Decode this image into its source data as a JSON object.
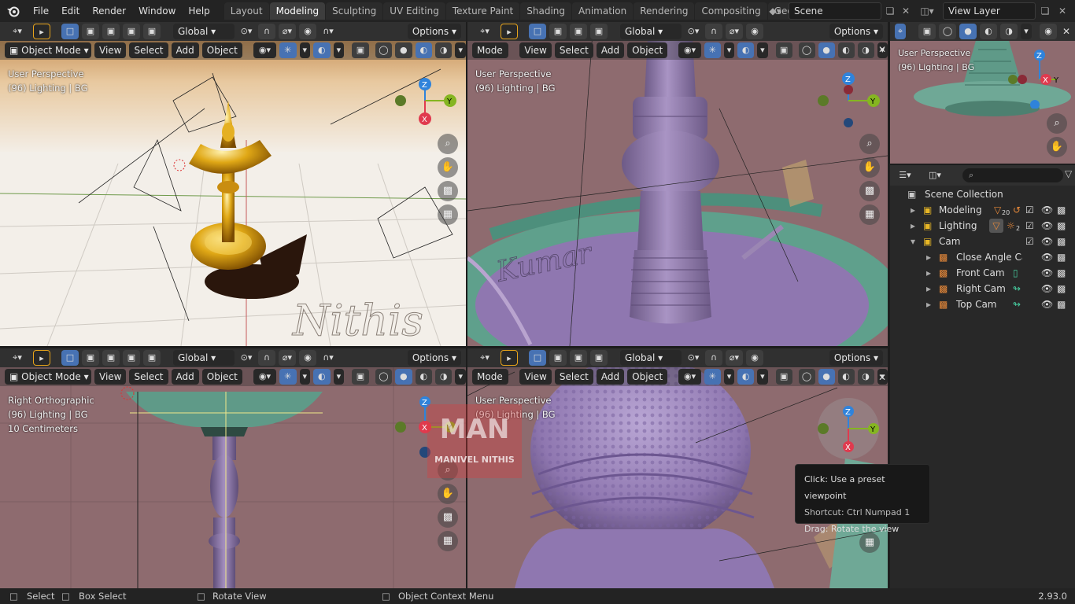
{
  "menus": [
    "File",
    "Edit",
    "Render",
    "Window",
    "Help"
  ],
  "workspace_tabs": [
    "Layout",
    "Modeling",
    "Sculpting",
    "UV Editing",
    "Texture Paint",
    "Shading",
    "Animation",
    "Rendering",
    "Compositing",
    "Geometry Nod"
  ],
  "active_tab": 1,
  "scene_name": "Scene",
  "view_layer_name": "View Layer",
  "viewport_header": {
    "transform": "Global",
    "options": "Options",
    "mode": "Object Mode",
    "mode_short": "Mode",
    "view": "View",
    "select": "Select",
    "add": "Add",
    "object": "Object"
  },
  "viewports": {
    "tl": {
      "line1": "User Perspective",
      "line2": "(96) Lighting | BG",
      "line3": ""
    },
    "tr": {
      "line1": "User Perspective",
      "line2": "(96) Lighting | BG",
      "line3": ""
    },
    "bl": {
      "line1": "Right Orthographic",
      "line2": "(96) Lighting | BG",
      "line3": "10 Centimeters"
    },
    "br": {
      "line1": "User Perspective",
      "line2": "(96) Lighting | BG",
      "line3": ""
    },
    "cam": {
      "line1": "User Perspective",
      "line2": "(96) Lighting | BG",
      "line3": ""
    }
  },
  "gizmo_axes": {
    "x": "X",
    "y": "Y",
    "z": "Z"
  },
  "outliner": {
    "root": "Scene Collection",
    "items": [
      {
        "label": "Modeling",
        "badge": "20",
        "level": 1
      },
      {
        "label": "Lighting",
        "badge": "2",
        "level": 1
      },
      {
        "label": "Cam",
        "badge": "",
        "level": 1
      },
      {
        "label": "Close Angle Cam",
        "badge": "",
        "level": 2
      },
      {
        "label": "Front Cam",
        "badge": "",
        "level": 2
      },
      {
        "label": "Right Cam",
        "badge": "",
        "level": 2
      },
      {
        "label": "Top Cam",
        "badge": "",
        "level": 2
      }
    ]
  },
  "tooltip": {
    "line1": "Click: Use a preset viewpoint",
    "line2": "Shortcut: Ctrl Numpad 1",
    "line3": "Drag: Rotate the view"
  },
  "watermarks": {
    "signature": "Nithis",
    "signature2": "Kumar",
    "badge": "MANIVEL NITHIS"
  },
  "statusbar": {
    "select": "Select",
    "box_select": "Box Select",
    "rotate": "Rotate View",
    "context": "Object Context Menu",
    "version": "2.93.0"
  },
  "colors": {
    "axis_x": "#e03a4e",
    "axis_y": "#85b521",
    "axis_z": "#2f83db",
    "active_blue": "#4772b3",
    "viewport_bg": "#8e6b6f",
    "purple_model": "#9d82b8",
    "teal_model": "#6fa896"
  }
}
